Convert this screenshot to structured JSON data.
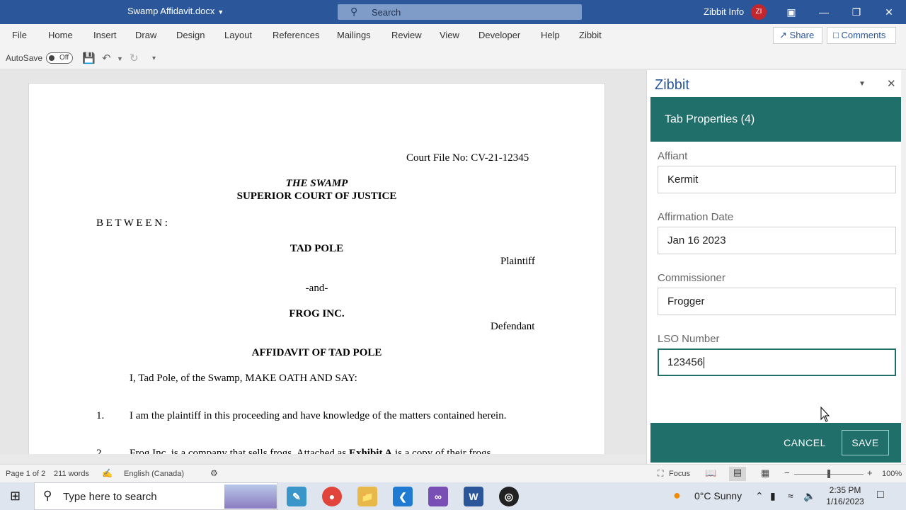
{
  "titlebar": {
    "doc_title": "Swamp Affidavit.docx",
    "search_placeholder": "Search",
    "user_name": "Zibbit Info",
    "user_initials": "ZI"
  },
  "menu": [
    "File",
    "Home",
    "Insert",
    "Draw",
    "Design",
    "Layout",
    "References",
    "Mailings",
    "Review",
    "View",
    "Developer",
    "Help",
    "Zibbit"
  ],
  "share_label": "Share",
  "comments_label": "Comments",
  "qat": {
    "autosave_label": "AutoSave",
    "toggle_state": "Off"
  },
  "document": {
    "court_file": "Court File No: CV-21-12345",
    "court_line1": "THE SWAMP",
    "court_line2": "SUPERIOR COURT OF JUSTICE",
    "between": "B E T W E E N :",
    "party1": "TAD POLE",
    "party1_role": "Plaintiff",
    "and": "-and-",
    "party2": "FROG INC.",
    "party2_role": "Defendant",
    "heading": "AFFIDAVIT OF TAD POLE",
    "oath": "I, Tad Pole, of the Swamp, MAKE OATH AND SAY:",
    "para1_num": "1.",
    "para1": "I am the plaintiff in this proceeding and have knowledge of the matters contained herein.",
    "para2_num": "2.",
    "para2_start": "Frog Inc. is a company that sells frogs. Attached as ",
    "para2_bold": "Exhibit A",
    "para2_end": " is a copy of their frogs."
  },
  "pane": {
    "title": "Zibbit",
    "header": "Tab Properties (4)",
    "fields": [
      {
        "label": "Affiant",
        "value": "Kermit"
      },
      {
        "label": "Affirmation Date",
        "value": "Jan 16 2023"
      },
      {
        "label": "Commissioner",
        "value": "Frogger"
      },
      {
        "label": "LSO Number",
        "value": "123456"
      }
    ],
    "cancel_label": "CANCEL",
    "save_label": "SAVE"
  },
  "status": {
    "page": "Page 1 of 2",
    "words": "211 words",
    "language": "English (Canada)",
    "focus": "Focus",
    "zoom": "100%",
    "zoom_level": 1.0
  },
  "taskbar": {
    "search_placeholder": "Type here to search",
    "weather": "0°C  Sunny",
    "time": "2:35 PM",
    "date": "1/16/2023"
  },
  "colors": {
    "word_blue": "#2b579a",
    "pane_teal": "#216f6b"
  }
}
